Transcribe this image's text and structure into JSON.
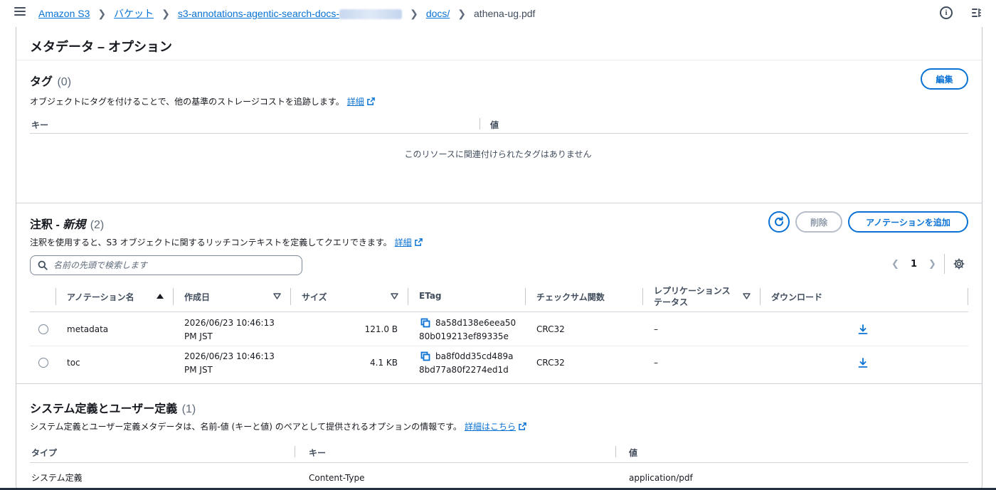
{
  "breadcrumb": {
    "items": [
      "Amazon S3",
      "バケット",
      "s3-annotations-agentic-search-docs-",
      "docs/"
    ],
    "current": "athena-ug.pdf"
  },
  "page": {
    "heading": "メタデータ – オプション"
  },
  "tags": {
    "title": "タグ",
    "count": "(0)",
    "description": "オブジェクトにタグを付けることで、他の基準のストレージコストを追跡します。",
    "link": "詳細",
    "edit_button": "編集",
    "columns": [
      "キー",
      "値"
    ],
    "empty_message": "このリソースに関連付けられたタグはありません"
  },
  "annotations": {
    "title_prefix": "注釈 - ",
    "title_emph": "新規",
    "count": "(2)",
    "description": "注釈を使用すると、S3 オブジェクトに関するリッチコンテキストを定義してクエリできます。",
    "link": "詳細",
    "delete_button": "削除",
    "add_button": "アノテーションを追加",
    "search_placeholder": "名前の先頭で検索します",
    "page_number": "1",
    "columns": [
      "アノテーション名",
      "作成日",
      "サイズ",
      "ETag",
      "チェックサム関数",
      "レプリケーションステータス",
      "ダウンロード"
    ],
    "column_line1": "レプリケーションス",
    "column_line2": "テータス",
    "rows": [
      {
        "name": "metadata",
        "created_1": "2026/06/23 10:46:13",
        "created_2": "PM JST",
        "size": "121.0 B",
        "etag_1": "8a58d138e6eea50",
        "etag_2": "80b019213ef89335e",
        "checksum": "CRC32",
        "replication": "–"
      },
      {
        "name": "toc",
        "created_1": "2026/06/23 10:46:13",
        "created_2": "PM JST",
        "size": "4.1 KB",
        "etag_1": "ba8f0dd35cd489a",
        "etag_2": "8bd77a80f2274ed1d",
        "checksum": "CRC32",
        "replication": "–"
      }
    ]
  },
  "system_metadata": {
    "title": "システム定義とユーザー定義",
    "count": "(1)",
    "description": "システム定義とユーザー定義メタデータは、名前-値 (キーと値) のペアとして提供されるオプションの情報です。",
    "link": "詳細はこちら",
    "columns": [
      "タイプ",
      "キー",
      "値"
    ],
    "rows": [
      {
        "type": "システム定義",
        "key": "Content-Type",
        "value": "application/pdf"
      }
    ]
  },
  "colors": {
    "accent": "#0972d3",
    "text": "#16191f",
    "border": "#c6c6cd"
  }
}
